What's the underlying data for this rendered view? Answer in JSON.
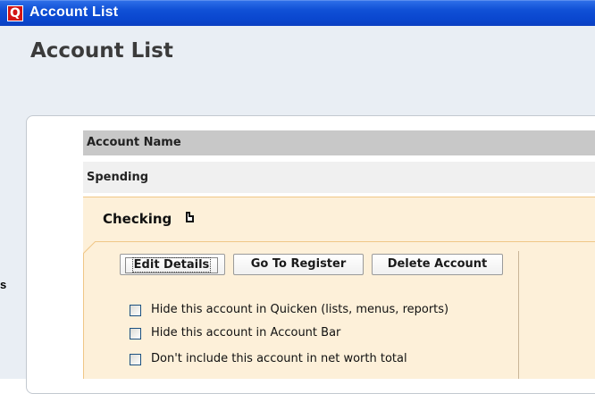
{
  "window": {
    "title": "Account List",
    "app_icon_letter": "Q"
  },
  "page": {
    "title": "Account List",
    "side_label": "s"
  },
  "table": {
    "header": "Account Name",
    "group": "Spending"
  },
  "account": {
    "name": "Checking",
    "buttons": {
      "edit": "Edit Details",
      "register": "Go To Register",
      "delete": "Delete Account"
    },
    "options": [
      {
        "label": "Hide this account in Quicken (lists, menus, reports)",
        "checked": false
      },
      {
        "label": "Hide this account in Account Bar",
        "checked": false
      },
      {
        "label": "Don't include this account in net worth total",
        "checked": false
      }
    ]
  },
  "colors": {
    "titlebar": "#0a47cf",
    "panel_accent": "#f0c787",
    "panel_bg": "#fdf0d9"
  }
}
